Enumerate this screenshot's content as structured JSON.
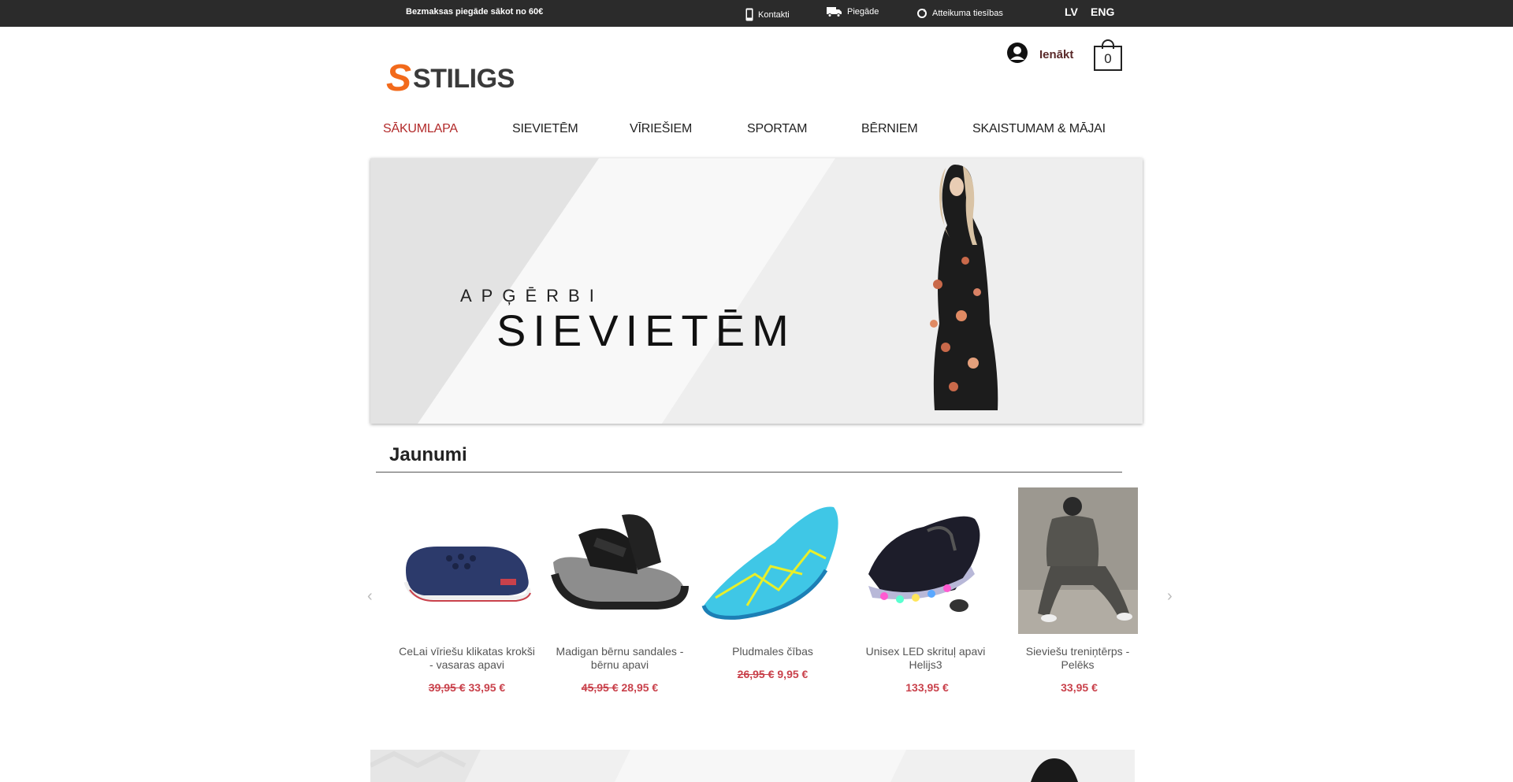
{
  "topbar": {
    "promo": "Bezmaksas piegāde sākot no 60€",
    "links": [
      {
        "label": "Kontakti",
        "icon": "phone-icon"
      },
      {
        "label": "Piegāde",
        "icon": "truck-icon"
      },
      {
        "label": "Atteikuma tiesības",
        "icon": "refresh-icon"
      }
    ],
    "languages": [
      "LV",
      "ENG"
    ]
  },
  "header": {
    "logo_letter": "S",
    "logo_word": "STILIGS",
    "login_label": "Ienākt",
    "cart_count": "0"
  },
  "nav": {
    "items": [
      {
        "label": "SĀKUMLAPA",
        "active": true
      },
      {
        "label": "SIEVIETĒM",
        "active": false
      },
      {
        "label": "VĪRIEŠIEM",
        "active": false
      },
      {
        "label": "SPORTAM",
        "active": false
      },
      {
        "label": "BĒRNIEM",
        "active": false
      },
      {
        "label": "SKAISTUMAM & MĀJAI",
        "active": false
      }
    ],
    "active_color": "#b22a2a"
  },
  "hero": {
    "subtitle": "APĢĒRBI",
    "title": "SIEVIETĒM"
  },
  "section": {
    "title": "Jaunumi"
  },
  "products": [
    {
      "name": "CeLai vīriešu klikatas krokši - vasaras apavi",
      "old_price": "39,95 €",
      "price": "33,95 €"
    },
    {
      "name": "Madigan bērnu sandales - bērnu apavi",
      "old_price": "45,95 €",
      "price": "28,95 €"
    },
    {
      "name": "Pludmales čības",
      "old_price": "26,95 €",
      "price": "9,95 €"
    },
    {
      "name": "Unisex LED skrituļ apavi Helijs3",
      "old_price": "",
      "price": "133,95 €"
    },
    {
      "name": "Sieviešu treniņtērps - Pelēks",
      "old_price": "",
      "price": "33,95 €"
    }
  ],
  "colors": {
    "topbar_bg": "#2b2b2b",
    "brand_orange": "#f26a1b",
    "price_red": "#c9414b"
  }
}
